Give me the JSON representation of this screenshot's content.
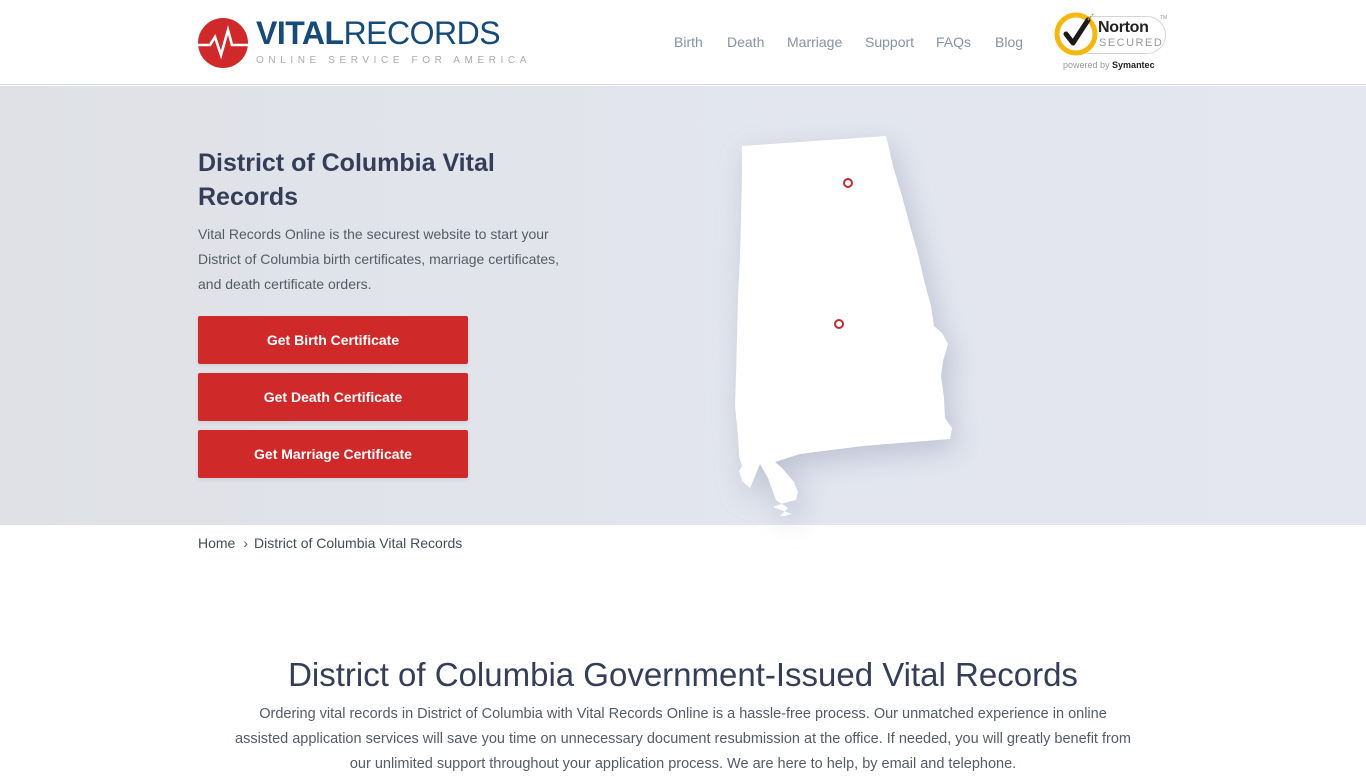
{
  "header": {
    "logo": {
      "word_bold": "VITAL",
      "word_light": "RECORDS",
      "tagline": "ONLINE SERVICE FOR AMERICA",
      "icon": "heartbeat-icon",
      "brand_color": "#164a78",
      "accent_color": "#d0292a"
    },
    "nav": [
      {
        "label": "Birth"
      },
      {
        "label": "Death"
      },
      {
        "label": "Marriage"
      },
      {
        "label": "Support"
      },
      {
        "label": "FAQs"
      },
      {
        "label": "Blog"
      }
    ],
    "badge": {
      "name": "Norton",
      "secured": "SECURED",
      "tm": "TM",
      "powered_by": "powered by",
      "company": "Symantec"
    }
  },
  "hero": {
    "title": "District of Columbia Vital Records",
    "description": "Vital Records Online is the securest website to start your District of Columbia birth certificates, marriage certificates, and death certificate orders.",
    "buttons": [
      {
        "label": "Get Birth Certificate"
      },
      {
        "label": "Get Death Certificate"
      },
      {
        "label": "Get Marriage Certificate"
      }
    ],
    "map": {
      "icon": "state-map-icon",
      "markers": 2,
      "marker_color": "#c62a2f"
    }
  },
  "breadcrumb": {
    "home": "Home",
    "separator": "›",
    "current": "District of Columbia Vital Records"
  },
  "section": {
    "title": "District of Columbia Government-Issued Vital Records",
    "body": "Ordering vital records in District of Columbia with Vital Records Online is a hassle-free process. Our unmatched experience in online assisted application services will save you time on unnecessary document resubmission at the office. If needed, you will greatly benefit from our unlimited support throughout your application process. We are here to help, by email and telephone."
  }
}
